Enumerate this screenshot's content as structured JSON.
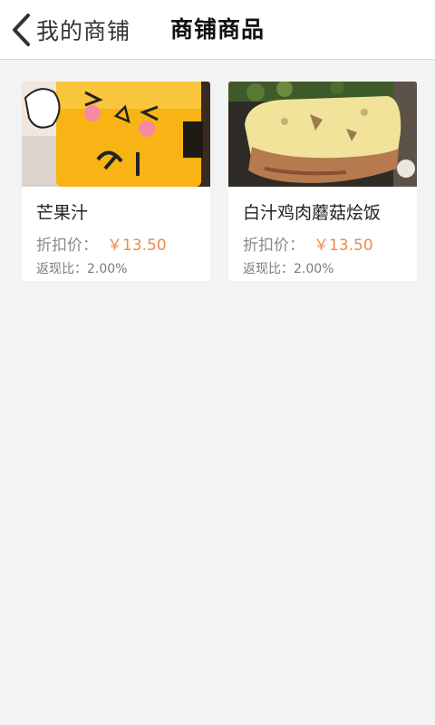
{
  "nav": {
    "back_label": "我的商铺",
    "title": "商铺商品"
  },
  "products": [
    {
      "name": "芒果汁",
      "price_label": "折扣价：",
      "price": "￥13.50",
      "cashback": "返现比：2.00%"
    },
    {
      "name": "白汁鸡肉蘑菇烩饭",
      "price_label": "折扣价：",
      "price": "￥13.50",
      "cashback": "返现比：2.00%"
    }
  ],
  "colors": {
    "accent_price": "#f08a4b",
    "background": "#f3f3f3"
  }
}
